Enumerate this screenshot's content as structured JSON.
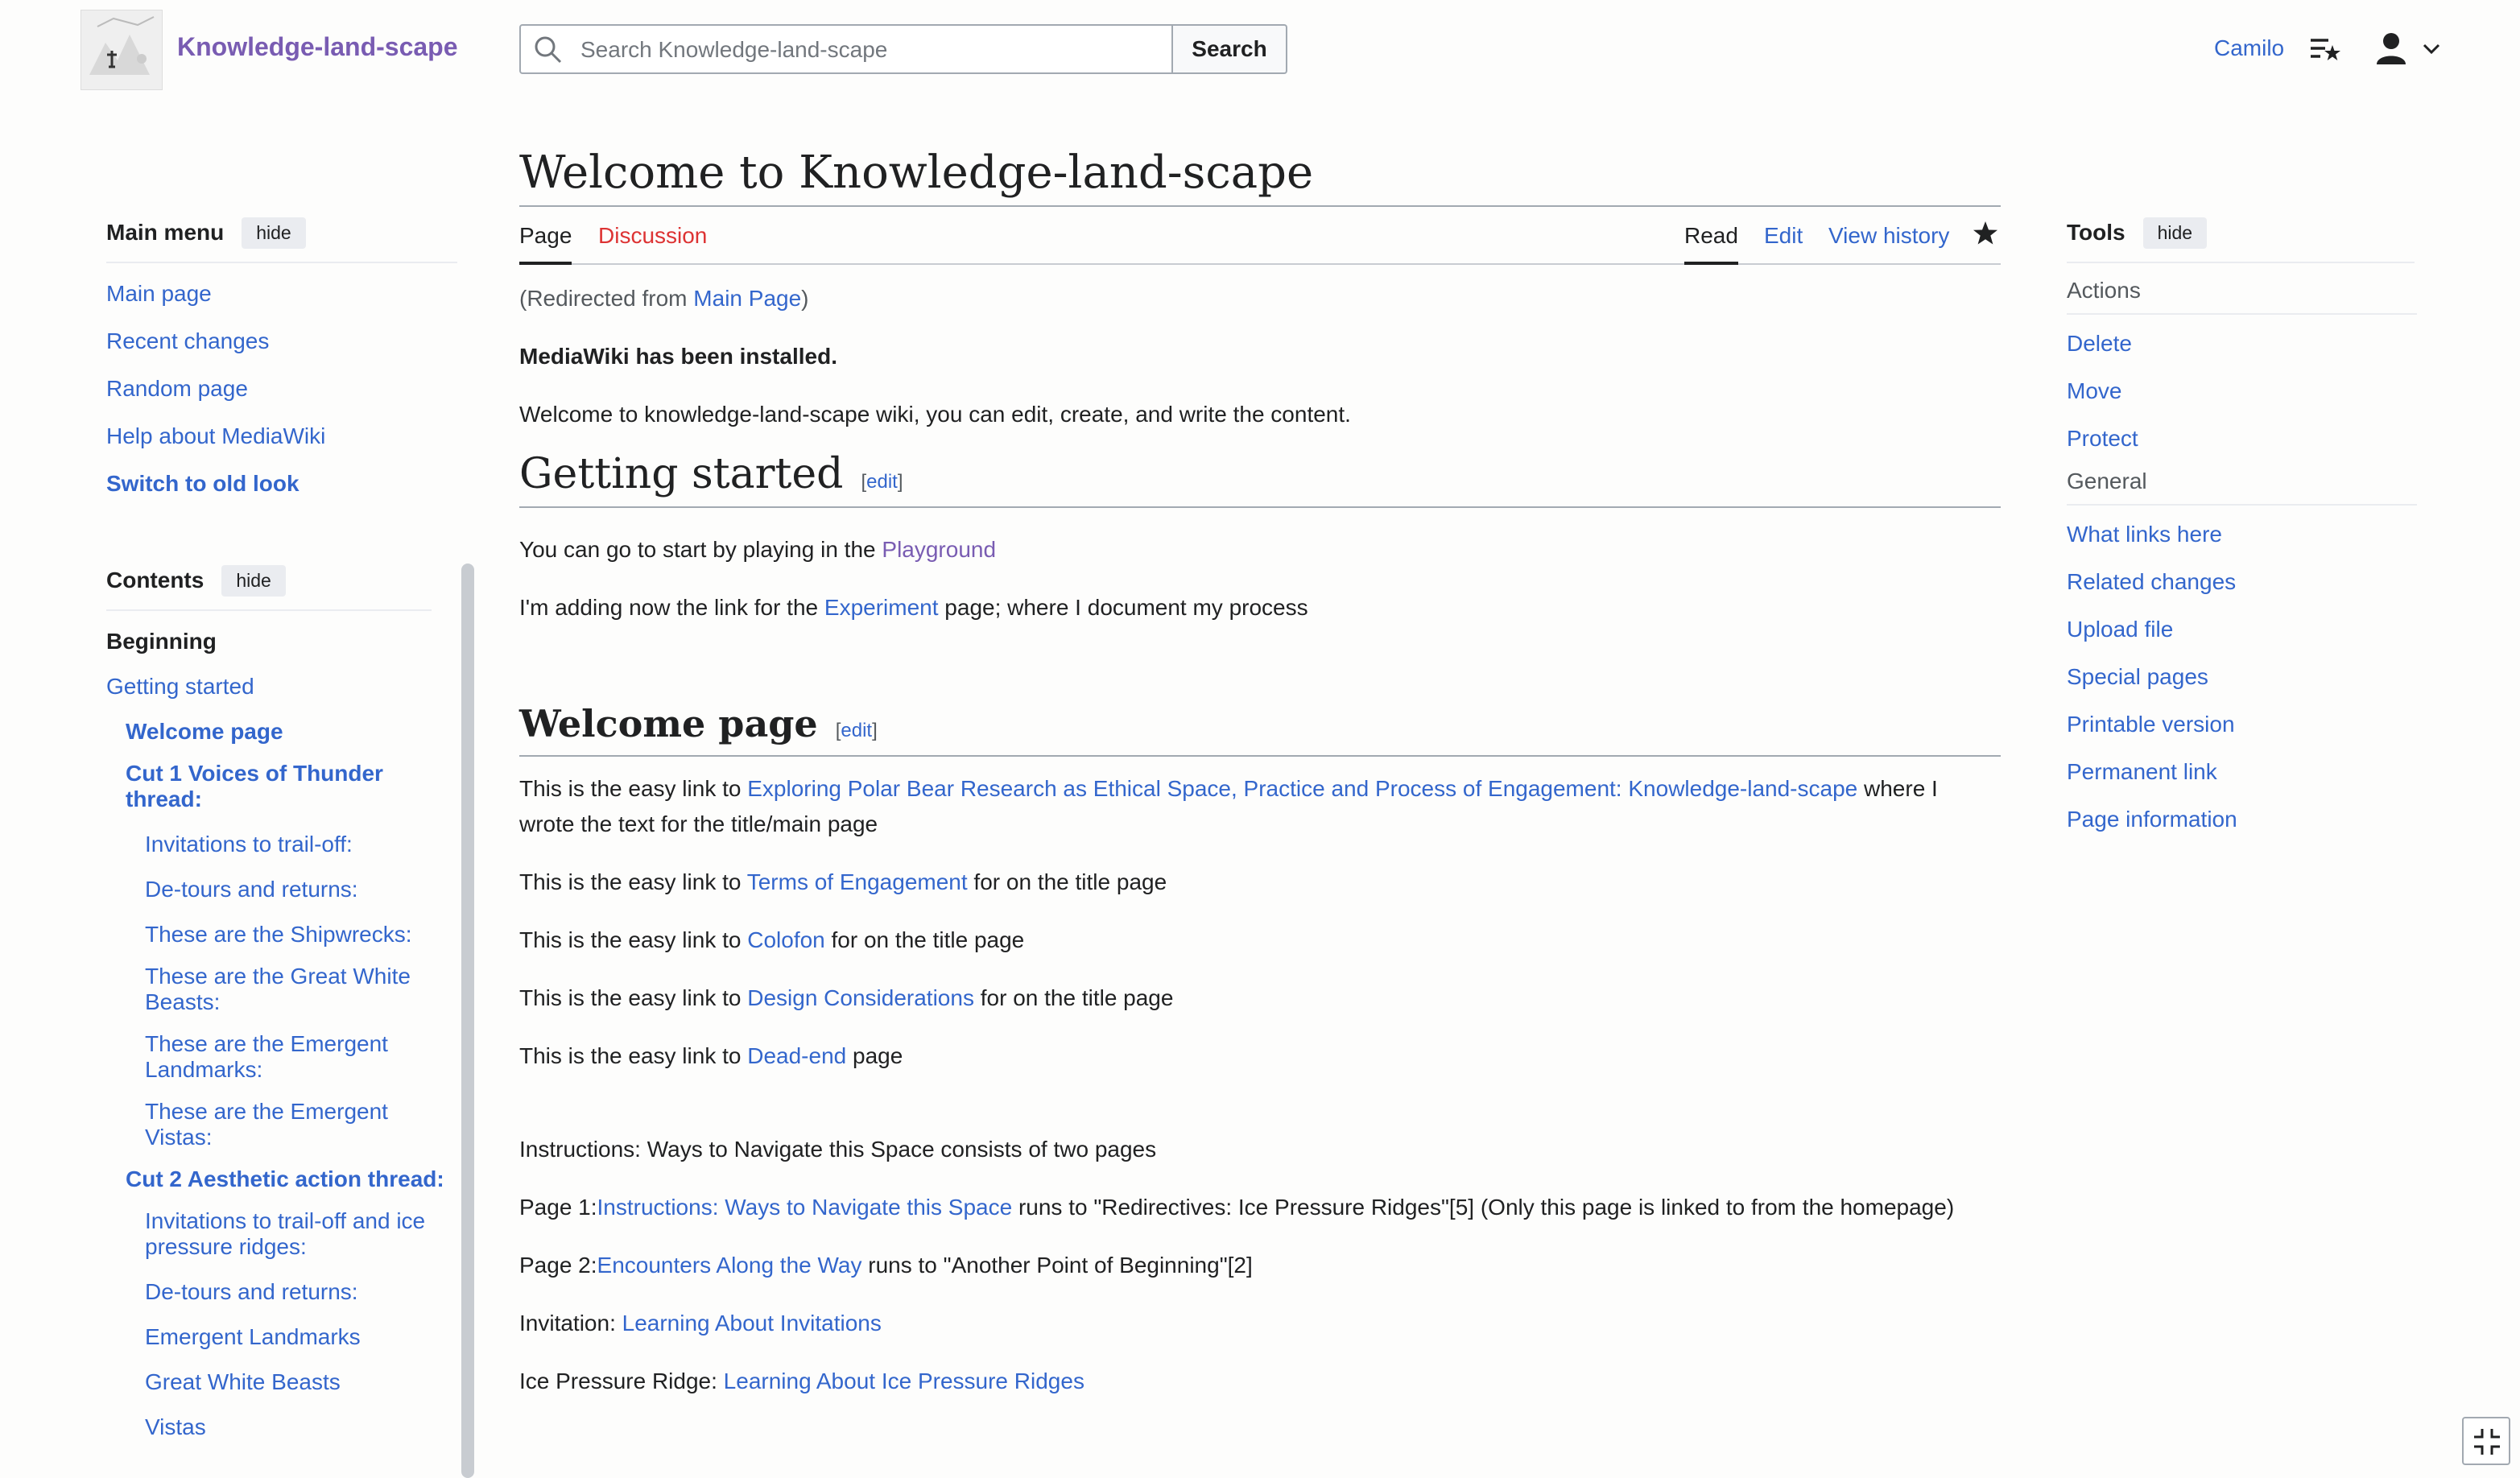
{
  "header": {
    "site_name": "Knowledge-land-scape",
    "search_placeholder": "Search Knowledge-land-scape",
    "search_button": "Search",
    "user_name": "Camilo"
  },
  "main_menu": {
    "title": "Main menu",
    "hide_label": "hide",
    "items": [
      {
        "label": "Main page"
      },
      {
        "label": "Recent changes"
      },
      {
        "label": "Random page"
      },
      {
        "label": "Help about MediaWiki"
      },
      {
        "label": "Switch to old look"
      }
    ]
  },
  "contents": {
    "title": "Contents",
    "hide_label": "hide",
    "items": [
      {
        "label": "Beginning"
      },
      {
        "label": "Getting started"
      },
      {
        "label": "Welcome page"
      },
      {
        "label": "Cut 1 Voices of Thunder thread:"
      },
      {
        "label": "Invitations to trail-off:"
      },
      {
        "label": "De-tours and returns:"
      },
      {
        "label": "These are the Shipwrecks:"
      },
      {
        "label": "These are the Great White Beasts:"
      },
      {
        "label": "These are the Emergent Landmarks:"
      },
      {
        "label": "These are the Emergent Vistas:"
      },
      {
        "label": "Cut 2 Aesthetic action thread:"
      },
      {
        "label": "Invitations to trail-off and ice pressure ridges:"
      },
      {
        "label": "De-tours and returns:"
      },
      {
        "label": "Emergent Landmarks"
      },
      {
        "label": "Great White Beasts"
      },
      {
        "label": "Vistas"
      }
    ]
  },
  "page": {
    "title": "Welcome to Knowledge-land-scape",
    "tabs": {
      "page": "Page",
      "discussion": "Discussion",
      "read": "Read",
      "edit": "Edit",
      "history": "View history"
    },
    "redirect": {
      "prefix": "(Redirected from ",
      "link": "Main Page",
      "suffix": ")"
    },
    "installed": "MediaWiki has been installed.",
    "intro": "Welcome to knowledge-land-scape wiki, you can edit, create, and write the content.",
    "edit_label": "edit",
    "section1": {
      "heading": "Getting started",
      "p1_text": "You can go to start by playing in the ",
      "p1_link": "Playground",
      "p2_text": "I'm adding now the link for the ",
      "p2_link": "Experiment",
      "p2_after": " page; where I document my process"
    },
    "section2": {
      "heading": "Welcome page",
      "easy": "This is the easy link to ",
      "l1": "Exploring Polar Bear Research as Ethical Space, Practice and Process of Engagement: Knowledge-land-scape",
      "l1_after": " where I wrote the text for the title/main page",
      "l2": "Terms of Engagement",
      "title_after": " for on the title page",
      "l3": "Colofon",
      "l4": "Design Considerations",
      "l5": "Dead-end",
      "l5_after": " page",
      "instructions": "Instructions: Ways to Navigate this Space consists of two pages",
      "page1_prefix": "Page 1:",
      "page1_link": "Instructions: Ways to Navigate this Space",
      "page1_after": " runs to \"Redirectives: Ice Pressure Ridges\"[5] (Only this page is linked to from the homepage)",
      "page2_prefix": "Page 2:",
      "page2_link": "Encounters Along the Way",
      "page2_after": " runs to \"Another Point of Beginning\"[2]",
      "invitation_prefix": "Invitation: ",
      "invitation_link": "Learning About Invitations",
      "ridge_prefix": "Ice Pressure Ridge: ",
      "ridge_link": "Learning About Ice Pressure Ridges"
    }
  },
  "tools": {
    "title": "Tools",
    "hide_label": "hide",
    "actions_label": "Actions",
    "actions": [
      {
        "label": "Delete"
      },
      {
        "label": "Move"
      },
      {
        "label": "Protect"
      }
    ],
    "general_label": "General",
    "general": [
      {
        "label": "What links here"
      },
      {
        "label": "Related changes"
      },
      {
        "label": "Upload file"
      },
      {
        "label": "Special pages"
      },
      {
        "label": "Printable version"
      },
      {
        "label": "Permanent link"
      },
      {
        "label": "Page information"
      }
    ]
  }
}
